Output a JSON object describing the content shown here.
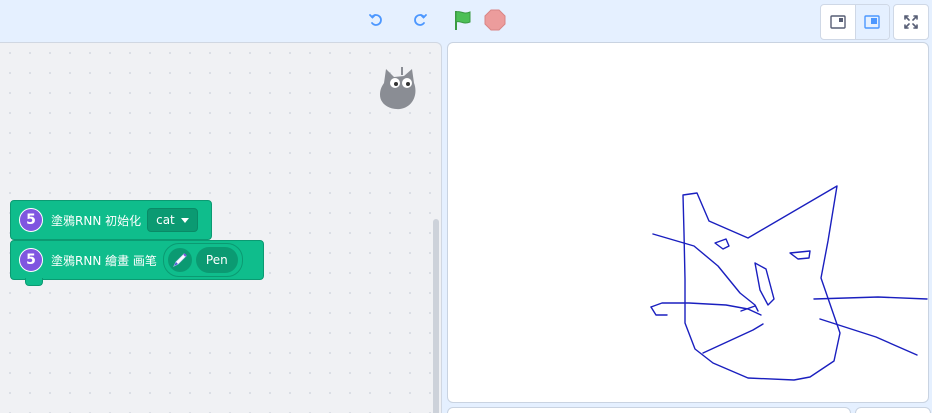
{
  "toolbar": {
    "undo_icon": "undo-icon",
    "redo_icon": "redo-icon",
    "green_flag_icon": "green-flag-icon",
    "stop_icon": "stop-icon",
    "layout_small_stage_icon": "small-stage-icon",
    "layout_large_stage_icon": "large-stage-icon",
    "fullscreen_icon": "fullscreen-icon",
    "accent_color": "#4c97ff",
    "flag_color": "#4cbf56",
    "stop_color": "#ec9c9c"
  },
  "workspace": {
    "sprite_icon": "cat-sprite-icon",
    "blocks": [
      {
        "extension_badge": "5",
        "label": "塗鴉RNN 初始化",
        "dropdown_value": "cat"
      },
      {
        "extension_badge": "5",
        "label": "塗鴉RNN 繪畫 画笔",
        "reporter_value": "Pen"
      }
    ],
    "block_color": "#0fbd8c",
    "extension_color": "#7f56e0"
  },
  "stage": {
    "drawing": "cat-doodle",
    "stroke_color": "#1a1fbf"
  }
}
